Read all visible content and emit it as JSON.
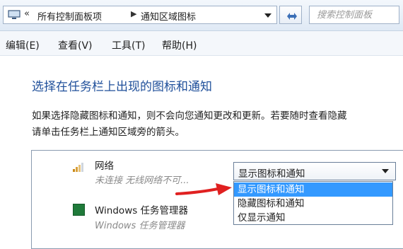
{
  "address_bar": {
    "breadcrumb_separator": "«",
    "crumbs": [
      "所有控制面板项",
      "通知区域图标"
    ]
  },
  "search": {
    "placeholder": "搜索控制面板"
  },
  "menu": [
    "编辑(E)",
    "查看(V)",
    "工具(T)",
    "帮助(H)"
  ],
  "main": {
    "title": "选择在任务栏上出现的图标和通知",
    "description_lines": [
      "如果选择隐藏图标和通知，则不会向您通知更改和更新。若要随时查看隐藏",
      "请单击任务栏上通知区域旁的箭头。"
    ]
  },
  "rows": [
    {
      "name": "网络",
      "subtitle": "未连接 无线网络不可..."
    },
    {
      "name": "Windows 任务管理器",
      "subtitle": "Windows 任务管理器"
    }
  ],
  "behavior_select": {
    "selected": "显示图标和通知",
    "options": [
      "显示图标和通知",
      "隐藏图标和通知",
      "仅显示通知"
    ],
    "highlighted_index": 0
  },
  "colors": {
    "title_blue": "#1f4f9a",
    "highlight": "#3399ff",
    "arrow_red": "#e02020",
    "task_manager_green": "#1f7a3a"
  }
}
